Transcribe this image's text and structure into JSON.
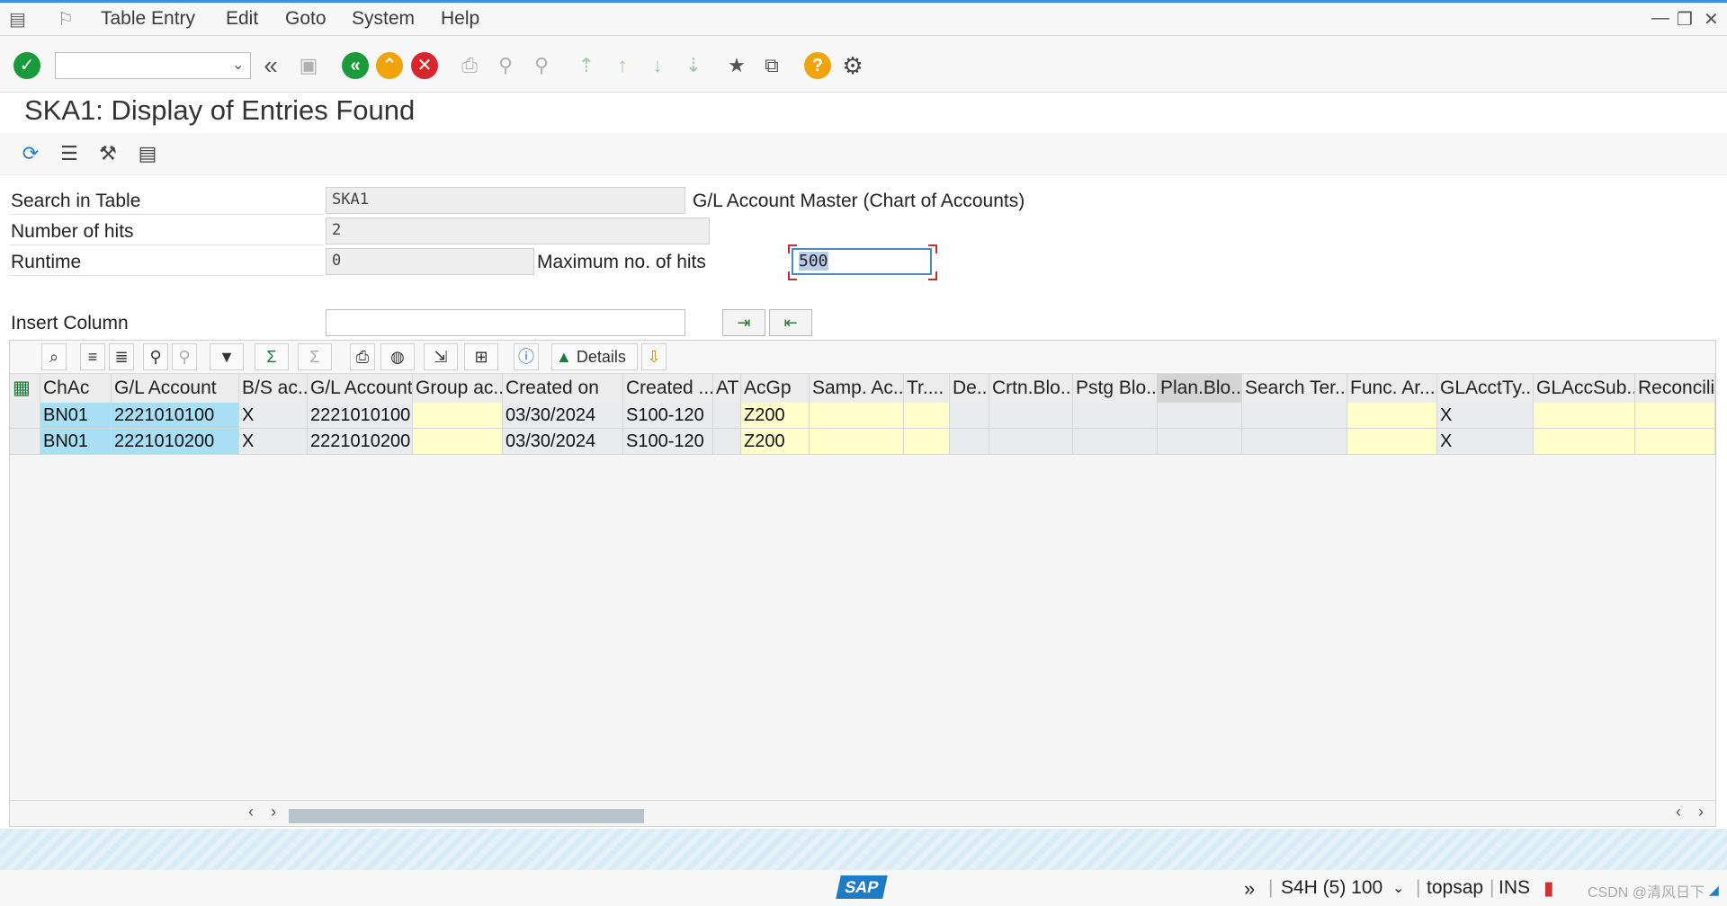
{
  "menu": [
    "Table Entry",
    "Edit",
    "Goto",
    "System",
    "Help"
  ],
  "toolbar": {
    "command_field_value": "",
    "icons": [
      "enter-icon",
      "dropdown-icon",
      "back-history-icon",
      "save-icon",
      "back-icon",
      "exit-icon",
      "cancel-icon",
      "print-icon",
      "find-icon",
      "find-next-icon",
      "first-page-icon",
      "previous-page-icon",
      "next-page-icon",
      "last-page-icon",
      "new-session-icon",
      "shortcut-icon",
      "help-icon",
      "settings-icon"
    ]
  },
  "page": {
    "title": "SKA1: Display of Entries Found"
  },
  "form": {
    "search_in_table_label": "Search in Table",
    "search_in_table_value": "SKA1",
    "search_in_table_desc": "G/L Account Master (Chart of Accounts)",
    "number_of_hits_label": "Number of hits",
    "number_of_hits_value": "2",
    "runtime_label": "Runtime",
    "runtime_value": "0",
    "max_hits_label": "Maximum no. of hits",
    "max_hits_value": "500",
    "insert_column_label": "Insert Column",
    "insert_column_value": ""
  },
  "grid": {
    "toolbar_details_label": "Details",
    "columns": [
      "ChAc",
      "G/L Account",
      "B/S ac...",
      "G/L Account",
      "Group ac...",
      "Created on",
      "Created ...",
      "AT",
      "AcGp",
      "Samp. Ac...",
      "Tr....",
      "De...",
      "Crtn.Blo...",
      "Pstg Blo...",
      "Plan.Blo...",
      "Search Ter...",
      "Func. Ar...",
      "GLAcctTy...",
      "GLAccSub...",
      "Reconcilia"
    ],
    "rows": [
      [
        "BN01",
        "2221010100",
        "X",
        "2221010100",
        "",
        "03/30/2024",
        "S100-120",
        "",
        "Z200",
        "",
        "",
        "",
        "",
        "",
        "",
        "",
        "",
        "X",
        "",
        ""
      ],
      [
        "BN01",
        "2221010200",
        "X",
        "2221010200",
        "",
        "03/30/2024",
        "S100-120",
        "",
        "Z200",
        "",
        "",
        "",
        "",
        "",
        "",
        "",
        "",
        "X",
        "",
        ""
      ]
    ]
  },
  "status": {
    "system": "S4H (5) 100",
    "user": "topsap",
    "mode": "INS",
    "logo": "SAP",
    "watermark": "CSDN @清风日下"
  },
  "colors": {
    "key_cell": "#a9dff5",
    "input_cell": "#ffffcc",
    "accent": "#3f8edb"
  }
}
